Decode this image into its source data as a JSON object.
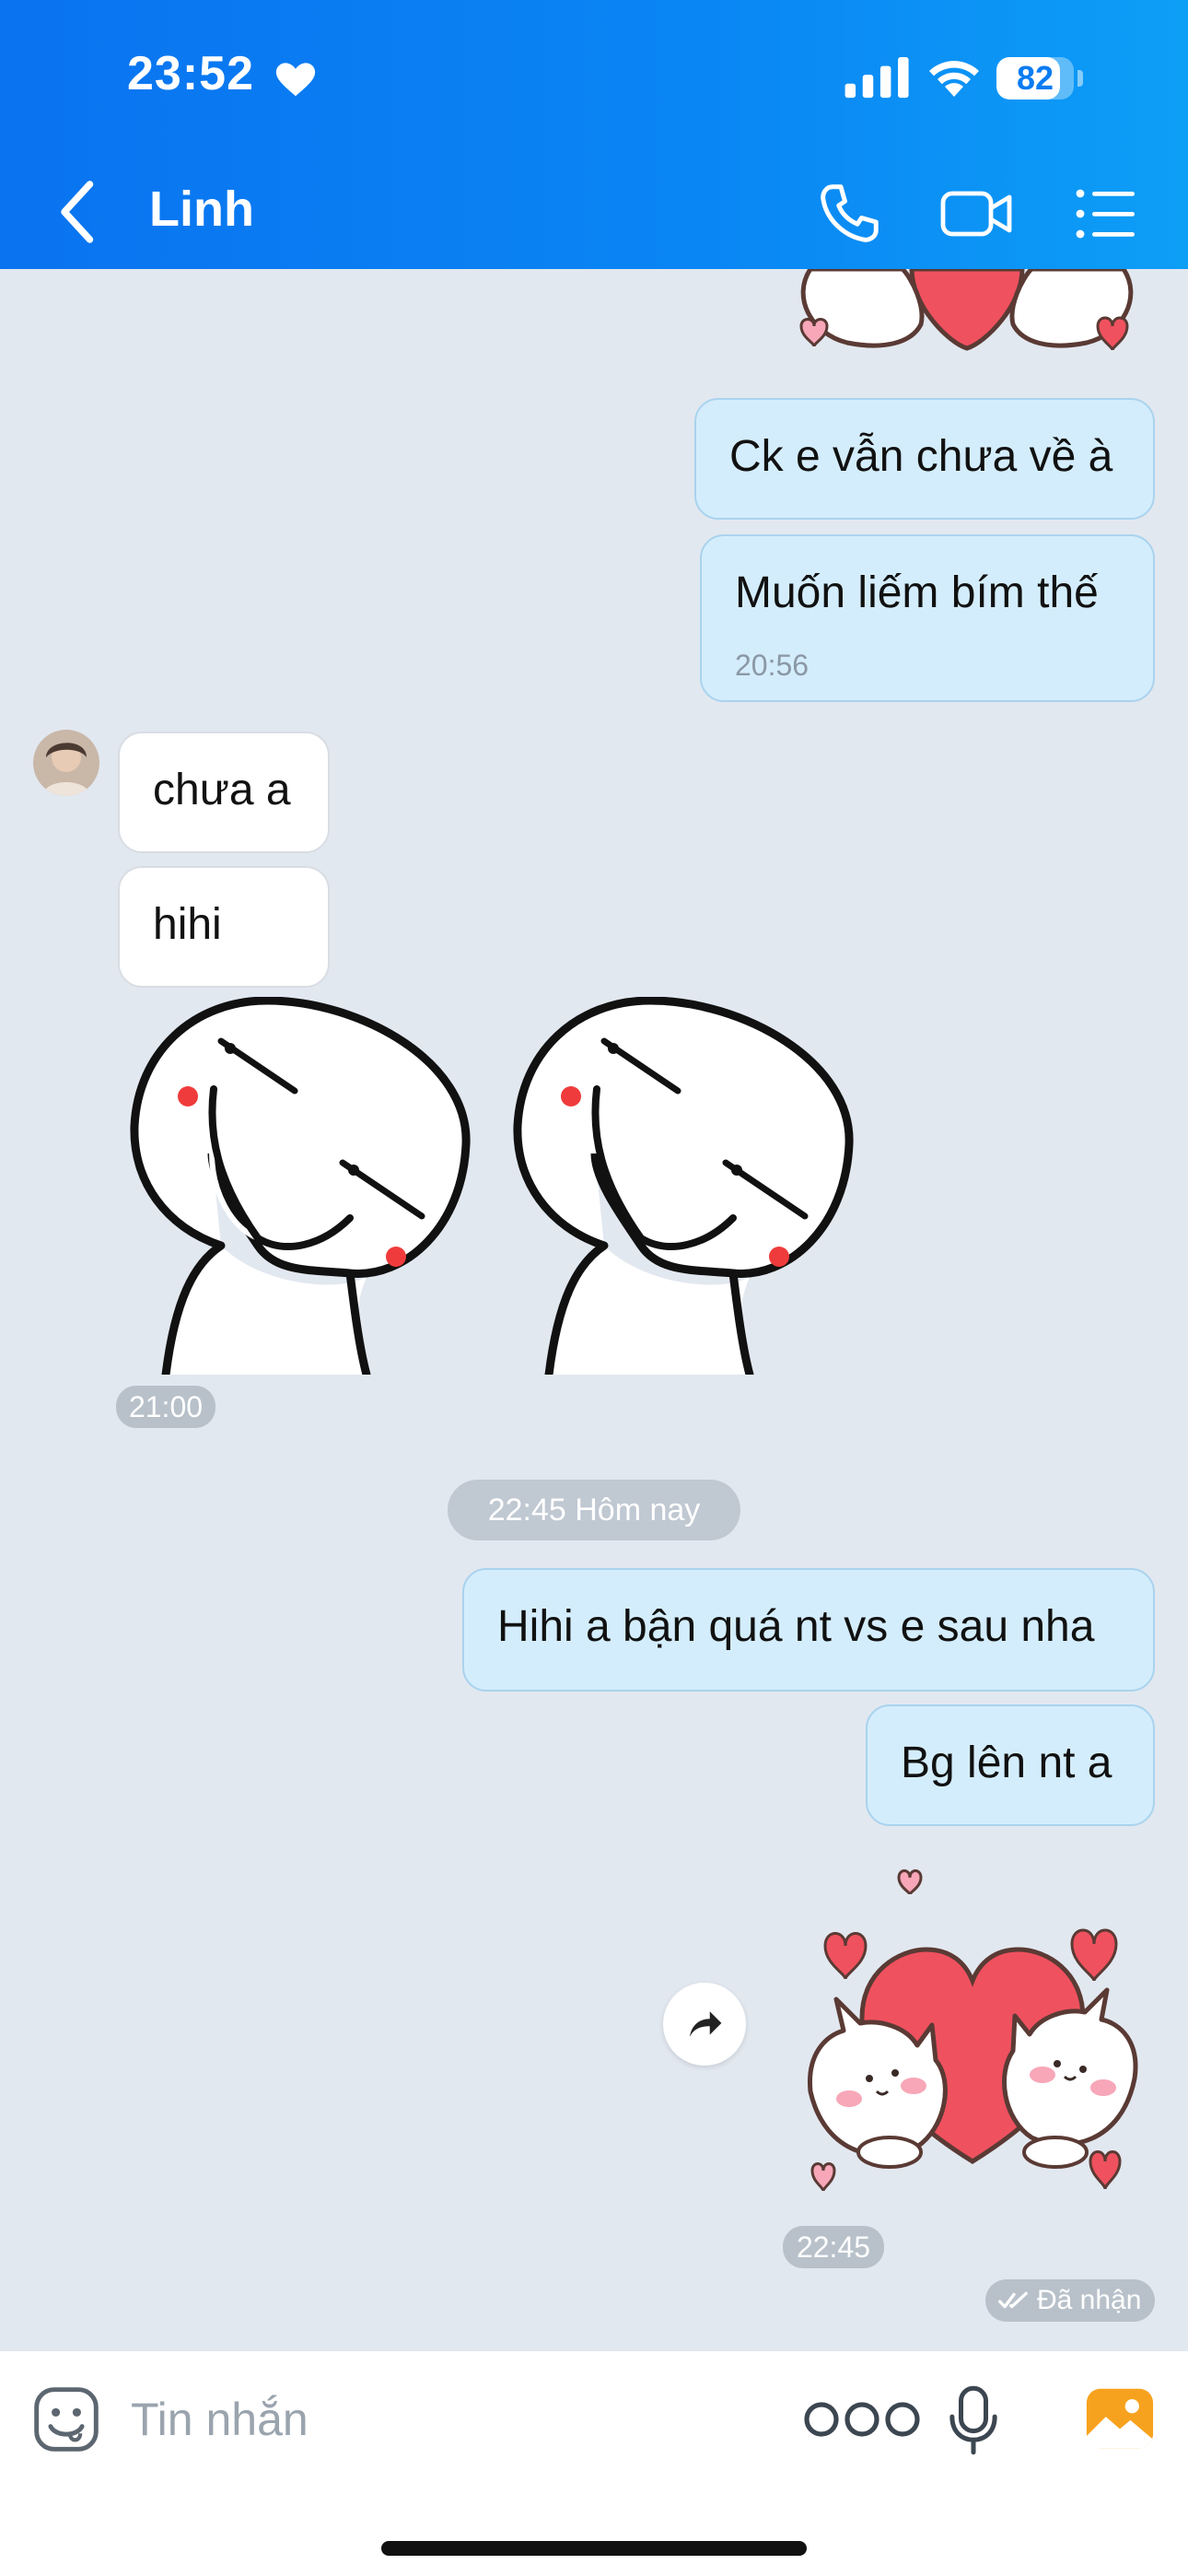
{
  "status_bar": {
    "time": "23:52",
    "battery": "82",
    "battery_level": 0.82
  },
  "header": {
    "title": "Linh"
  },
  "messages": {
    "out1": "Ck e vẫn chưa về à",
    "out2": "Muốn liếm bím thế",
    "out2_time": "20:56",
    "in1": "chưa a",
    "in2": "hihi",
    "sticker_time": "21:00",
    "date_separator": "22:45 Hôm nay",
    "out3": "Hihi a bận quá nt vs e sau nha",
    "out4": "Bg lên nt a",
    "sticker2_time": "22:45",
    "receipt": "Đã nhận"
  },
  "composer": {
    "placeholder": "Tin nhắn"
  },
  "colors": {
    "header": "#0a80f2",
    "bubble_out": "#d4edfc",
    "bubble_in": "#ffffff",
    "background": "#e2e8f0"
  }
}
